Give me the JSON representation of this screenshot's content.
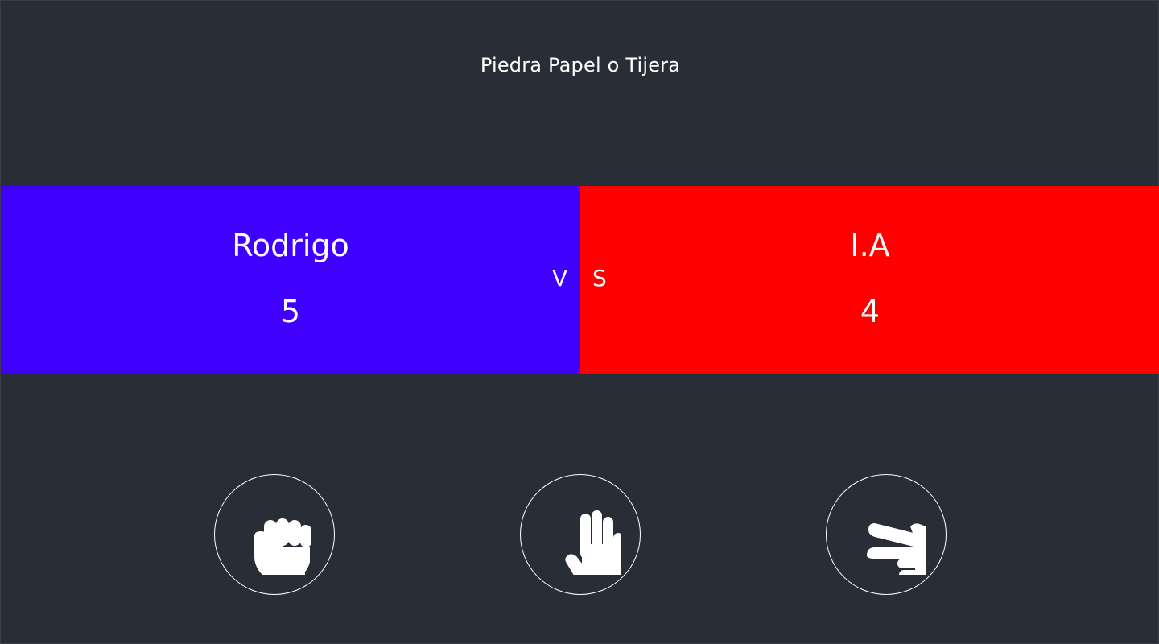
{
  "app": {
    "title": "Piedra Papel o Tijera"
  },
  "colors": {
    "background": "#292d36",
    "player_panel": "#4000ff",
    "opponent_panel": "#ff0000",
    "text": "#ffffff"
  },
  "scoreboard": {
    "player": {
      "name": "Rodrigo",
      "score": "5"
    },
    "opponent": {
      "name": "I.A",
      "score": "4"
    },
    "vs_left": "V",
    "vs_right": "S"
  },
  "choices": [
    {
      "id": "rock",
      "icon": "fist-icon"
    },
    {
      "id": "paper",
      "icon": "open-hand-icon"
    },
    {
      "id": "scissors",
      "icon": "scissors-hand-icon"
    }
  ]
}
